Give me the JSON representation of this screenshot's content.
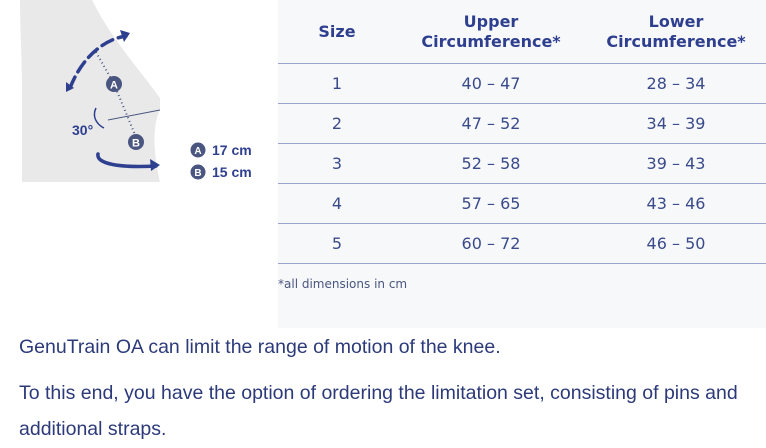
{
  "diagram": {
    "angle_label": "30°",
    "point_a": "A",
    "point_b": "B",
    "legend": [
      {
        "marker": "A",
        "value": "17 cm"
      },
      {
        "marker": "B",
        "value": "15 cm"
      }
    ]
  },
  "size_table": {
    "headers": {
      "size": "Size",
      "upper_line1": "Upper",
      "upper_line2": "Circumference*",
      "lower_line1": "Lower",
      "lower_line2": "Circumference*"
    },
    "rows": [
      {
        "size": "1",
        "upper": "40 – 47",
        "lower": "28 – 34"
      },
      {
        "size": "2",
        "upper": "47 – 52",
        "lower": "34 – 39"
      },
      {
        "size": "3",
        "upper": "52 – 58",
        "lower": "39 – 43"
      },
      {
        "size": "4",
        "upper": "57 – 65",
        "lower": "43 – 46"
      },
      {
        "size": "5",
        "upper": "60 – 72",
        "lower": "46 – 50"
      }
    ],
    "footnote": "*all dimensions in cm"
  },
  "paragraphs": [
    "GenuTrain OA can limit the range of motion of the knee.",
    "To this end, you have the option of ordering the limitation set, consisting of pins and additional straps."
  ],
  "colors": {
    "brand_blue": "#2f3f8f",
    "leg_gray": "#e9e9e9",
    "table_background": "#f7f8fa"
  }
}
